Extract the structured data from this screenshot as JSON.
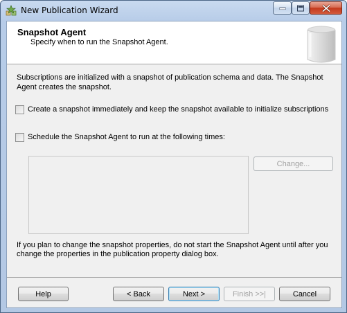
{
  "window": {
    "title": "New Publication Wizard"
  },
  "header": {
    "title": "Snapshot Agent",
    "subtitle": "Specify when to run the Snapshot Agent."
  },
  "content": {
    "description": "Subscriptions are initialized with a snapshot of publication schema and data. The Snapshot Agent creates the snapshot.",
    "create_snapshot_checkbox": {
      "label": "Create a snapshot immediately and keep the snapshot available to initialize subscriptions",
      "checked": false
    },
    "schedule_checkbox": {
      "label": "Schedule the Snapshot Agent to run at the following times:",
      "checked": false
    },
    "change_button_label": "Change...",
    "note": "If you plan to change the snapshot properties, do not start the Snapshot Agent until after you change the properties in the publication property dialog box."
  },
  "footer": {
    "help_label": "Help",
    "back_label": "< Back",
    "next_label": "Next >",
    "finish_label": "Finish >>|",
    "cancel_label": "Cancel"
  },
  "colors": {
    "title_bar": "#b9cde8",
    "close_button": "#c4391c",
    "dialog_background": "#f0f0f0",
    "default_button_border": "#3c7fb1"
  },
  "icons": [
    "app-icon",
    "minimize-icon",
    "maximize-icon",
    "close-icon",
    "wizard-header-graphic"
  ]
}
